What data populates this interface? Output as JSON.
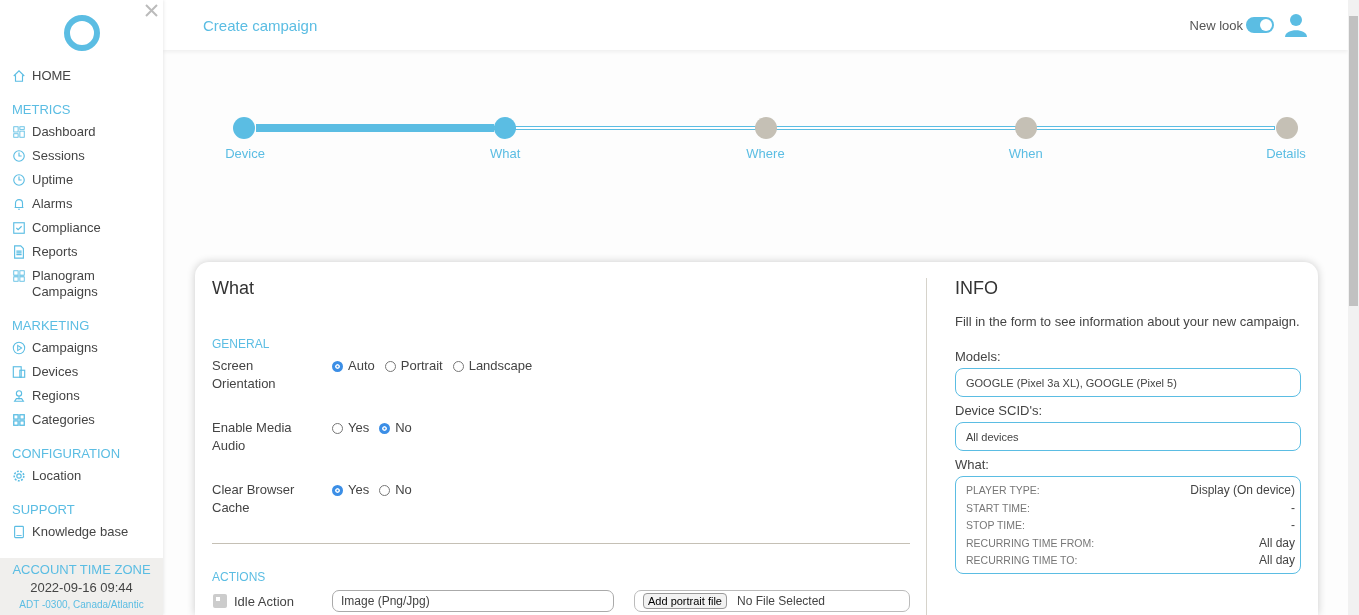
{
  "sidebar": {
    "home": "HOME",
    "sections": [
      {
        "title": "METRICS",
        "items": [
          {
            "label": "Dashboard",
            "kind": "dashboard"
          },
          {
            "label": "Sessions",
            "kind": "history"
          },
          {
            "label": "Uptime",
            "kind": "clock"
          },
          {
            "label": "Alarms",
            "kind": "bell"
          },
          {
            "label": "Compliance",
            "kind": "check"
          },
          {
            "label": "Reports",
            "kind": "doc"
          },
          {
            "label": "Planogram Campaigns",
            "kind": "planogram"
          }
        ]
      },
      {
        "title": "MARKETING",
        "items": [
          {
            "label": "Campaigns",
            "kind": "play"
          },
          {
            "label": "Devices",
            "kind": "devices"
          },
          {
            "label": "Regions",
            "kind": "pin"
          },
          {
            "label": "Categories",
            "kind": "grid"
          }
        ]
      },
      {
        "title": "CONFIGURATION",
        "items": [
          {
            "label": "Location",
            "kind": "gear"
          }
        ]
      },
      {
        "title": "SUPPORT",
        "items": [
          {
            "label": "Knowledge base",
            "kind": "book"
          }
        ]
      }
    ],
    "timezone": {
      "title": "ACCOUNT TIME ZONE",
      "datetime": "2022-09-16 09:44",
      "zone": "ADT -0300, Canada/Atlantic"
    }
  },
  "header": {
    "title": "Create campaign",
    "new_look": {
      "label": "New look",
      "on": true
    }
  },
  "stepper": {
    "level": 0.25,
    "steps": [
      {
        "label": "Device",
        "completed": true
      },
      {
        "label": "What",
        "completed": true
      },
      {
        "label": "Where",
        "completed": false
      },
      {
        "label": "When",
        "completed": false
      },
      {
        "label": "Details",
        "completed": false
      }
    ]
  },
  "form": {
    "title": "What",
    "general_title": "GENERAL",
    "general": [
      {
        "label": "Screen Orientation",
        "options": [
          {
            "label": "Auto",
            "selected": true
          },
          {
            "label": "Portrait",
            "selected": false
          },
          {
            "label": "Landscape",
            "selected": false
          }
        ]
      },
      {
        "label": "Enable Media Audio",
        "options": [
          {
            "label": "Yes",
            "selected": false
          },
          {
            "label": "No",
            "selected": true
          }
        ]
      },
      {
        "label": "Clear Browser Cache",
        "options": [
          {
            "label": "Yes",
            "selected": true
          },
          {
            "label": "No",
            "selected": false
          }
        ]
      }
    ],
    "actions_title": "ACTIONS",
    "idle_action": {
      "label": "Idle Action",
      "value": "Image (Png/Jpg)",
      "file_button": "Add portrait file",
      "file_status": "No File Selected"
    }
  },
  "info": {
    "title": "INFO",
    "intro": "Fill in the form to see information about your new campaign.",
    "models_label": "Models:",
    "models": "GOOGLE (Pixel 3a XL), GOOGLE (Pixel 5)",
    "scids_label": "Device SCID's:",
    "scids": "All devices",
    "what_label": "What:",
    "what": [
      {
        "key": "PLAYER TYPE:",
        "value": "Display (On device)"
      },
      {
        "key": "START TIME:",
        "value": "-"
      },
      {
        "key": "STOP TIME:",
        "value": "-"
      },
      {
        "key": "RECURRING TIME FROM:",
        "value": "All day"
      },
      {
        "key": "RECURRING TIME TO:",
        "value": "All day"
      }
    ]
  }
}
